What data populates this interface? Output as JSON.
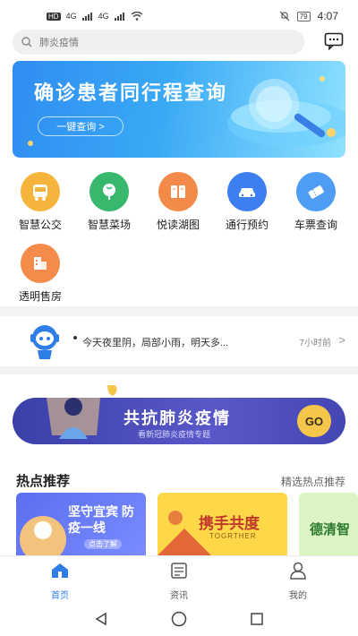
{
  "status_bar": {
    "left_badges": [
      "HD",
      "4G",
      "4G"
    ],
    "battery": "79",
    "time": "4:07"
  },
  "search": {
    "placeholder": "肺炎疫情"
  },
  "banner": {
    "title": "确诊患者同行程查询",
    "button_label": "一键查询 >"
  },
  "services": [
    {
      "label": "智慧公交",
      "icon": "bus-icon",
      "color": "#f5b53d"
    },
    {
      "label": "智慧菜场",
      "icon": "vegetable-icon",
      "color": "#37b86d"
    },
    {
      "label": "悦读湖图",
      "icon": "book-icon",
      "color": "#f38a4a"
    },
    {
      "label": "通行预约",
      "icon": "car-icon",
      "color": "#3d7ef0"
    },
    {
      "label": "车票查询",
      "icon": "ticket-icon",
      "color": "#4f9cf5"
    },
    {
      "label": "透明售房",
      "icon": "building-icon",
      "color": "#f48b4b"
    }
  ],
  "notice": {
    "text": "今天夜里阴，局部小雨，明天多...",
    "time": "7小时前"
  },
  "promo": {
    "title": "共抗肺炎疫情",
    "subtitle": "看新冠肺炎疫情专题",
    "go_label": "GO"
  },
  "hot": {
    "title": "热点推荐",
    "more_label": "精选热点推荐",
    "cards": [
      {
        "title": "坚守宜宾 防疫一线",
        "sub": "点击了解"
      },
      {
        "title": "携手共度",
        "sub": "TOGRTHER"
      },
      {
        "title": "德清智"
      }
    ]
  },
  "tabs": [
    {
      "label": "首页",
      "icon": "home-icon",
      "active": true
    },
    {
      "label": "资讯",
      "icon": "news-icon",
      "active": false
    },
    {
      "label": "我的",
      "icon": "profile-icon",
      "active": false
    }
  ],
  "colors": {
    "accent": "#2f7ee8",
    "banner_start": "#2f8df2",
    "promo": "#4446b3",
    "go": "#f5c64a"
  }
}
